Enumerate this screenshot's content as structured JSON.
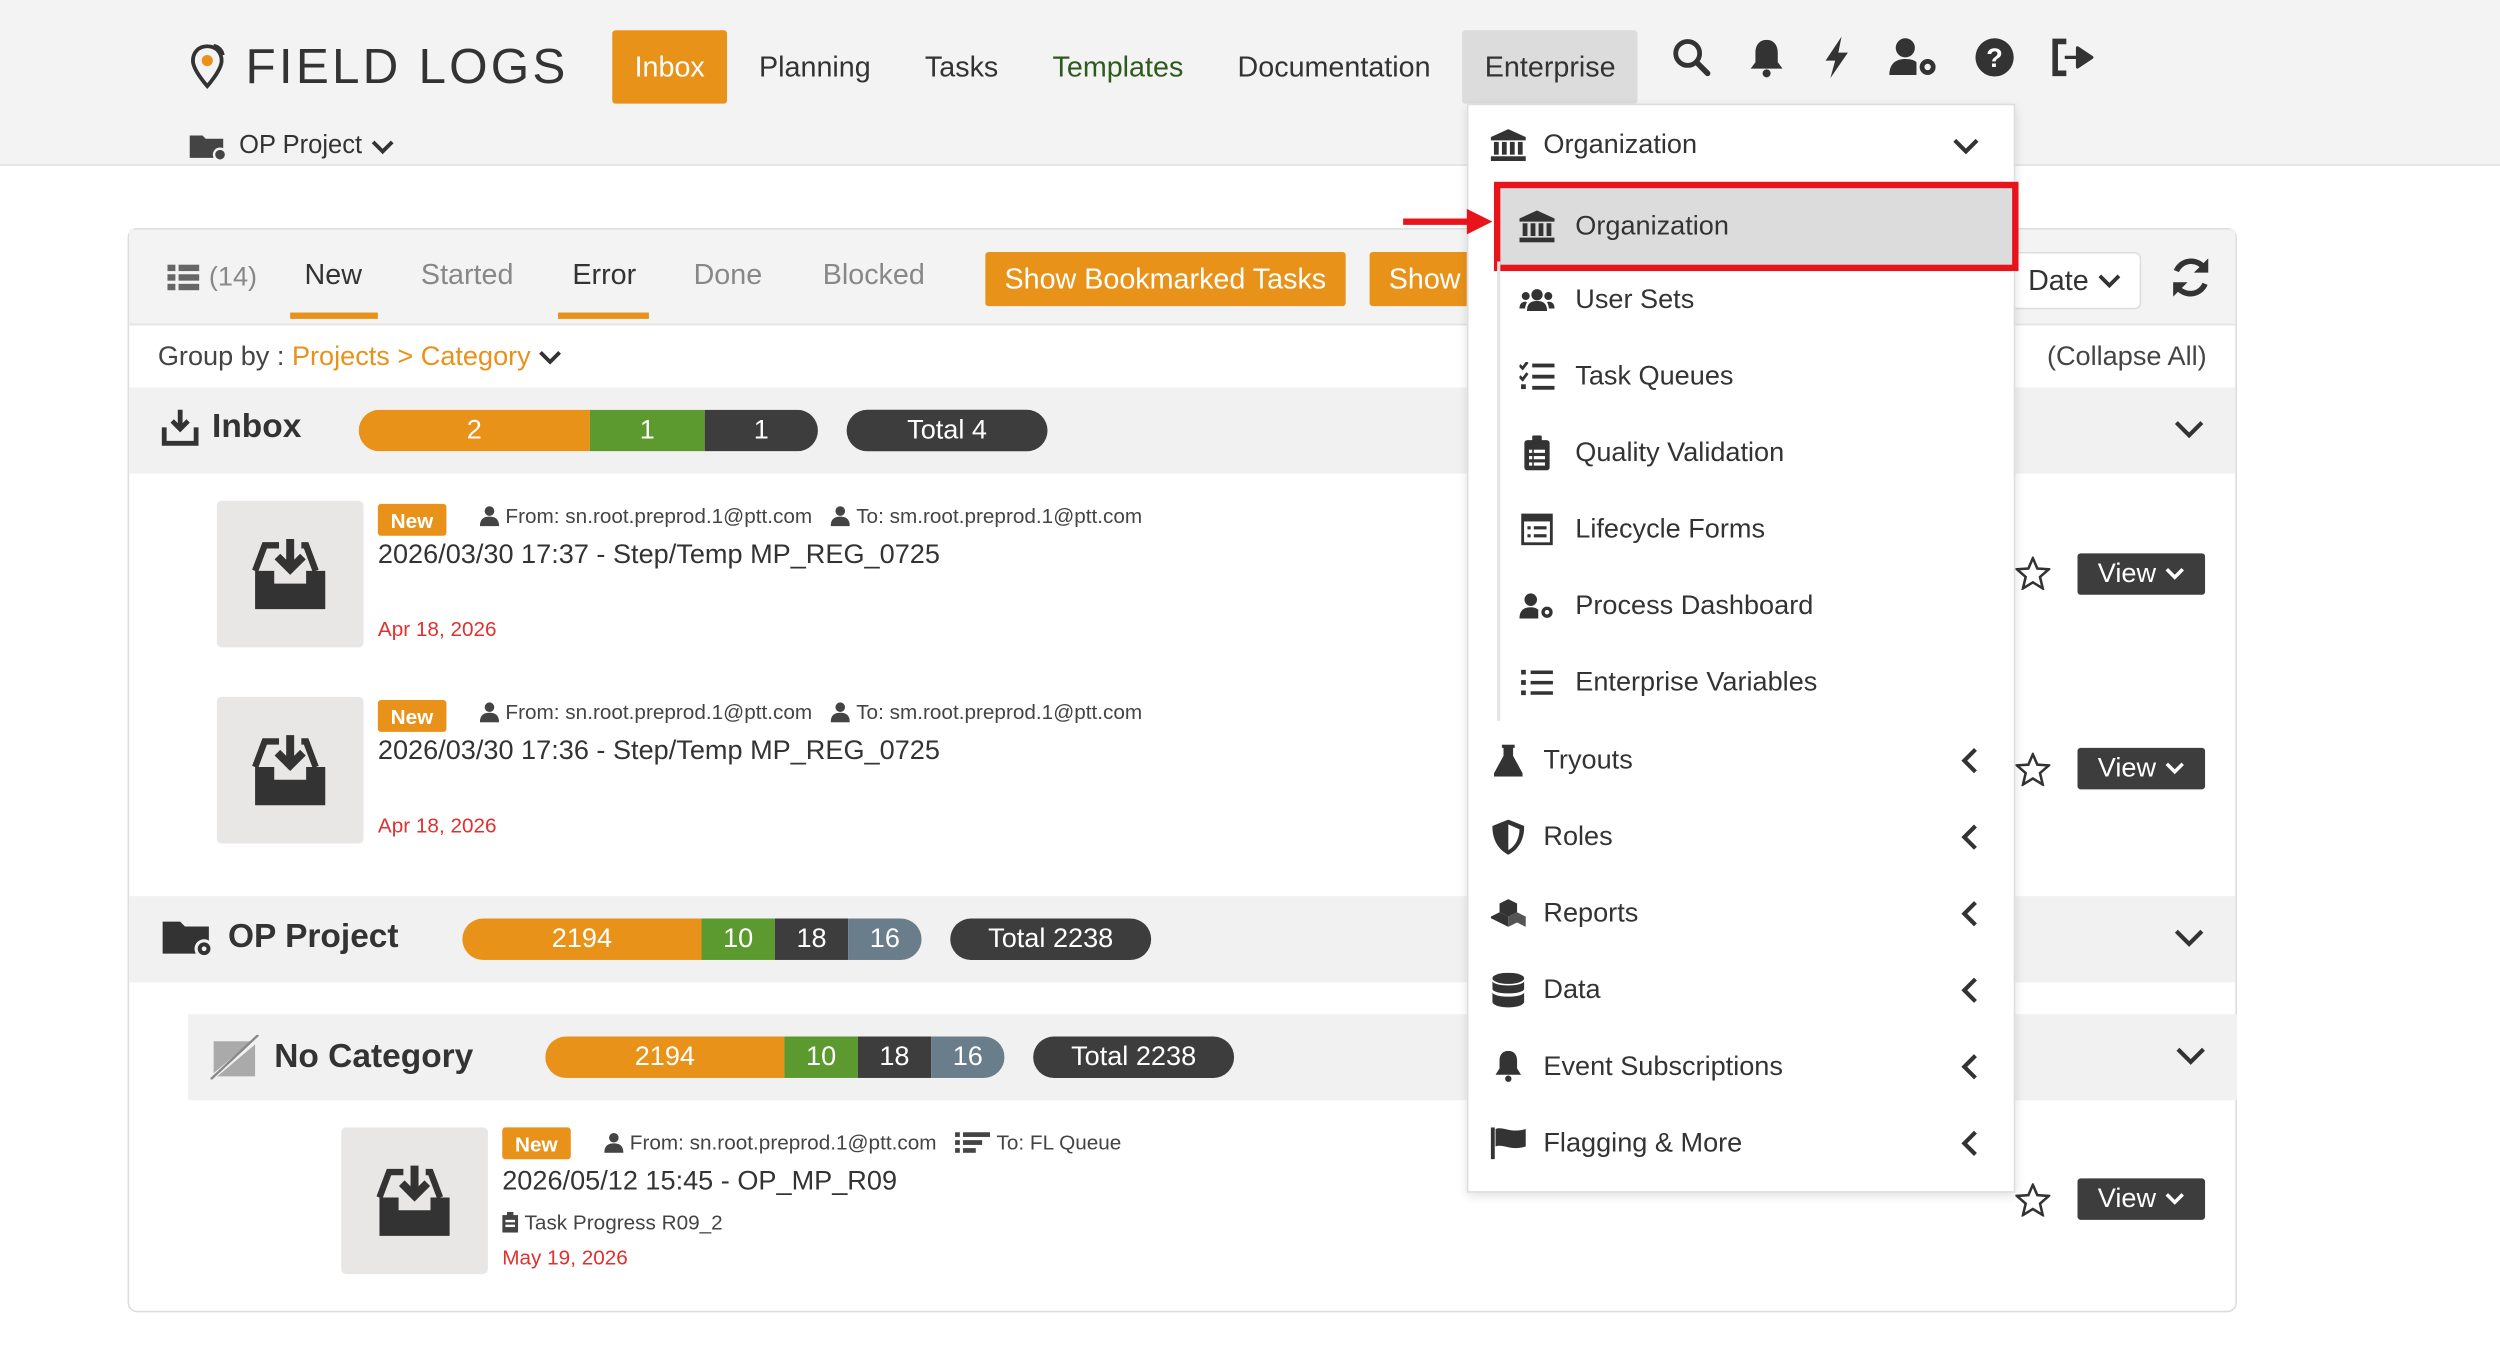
{
  "header": {
    "logo_text": "FIELD LOGS",
    "project_label": "OP Project",
    "nav": [
      {
        "label": "Inbox"
      },
      {
        "label": "Planning"
      },
      {
        "label": "Tasks"
      },
      {
        "label": "Templates"
      },
      {
        "label": "Documentation"
      },
      {
        "label": "Enterprise"
      }
    ],
    "icons": [
      "search-icon",
      "bell-icon",
      "bolt-icon",
      "user-gear-icon",
      "help-icon",
      "logout-icon"
    ]
  },
  "toolbar": {
    "list_count": "(14)",
    "tabs": [
      "New",
      "Started",
      "Error",
      "Done",
      "Blocked"
    ],
    "bookmarked_label": "Show Bookmarked Tasks",
    "show_label": "Show",
    "sort_label": "Date"
  },
  "groupby": {
    "prefix": "Group by : ",
    "value": "Projects > Category",
    "collapse_all": "(Collapse All)"
  },
  "inbox_section": {
    "title": "Inbox",
    "bar": [
      "2",
      "1",
      "1"
    ],
    "total": "Total 4",
    "tasks": [
      {
        "badge": "New",
        "from": "From: sn.root.preprod.1@ptt.com",
        "to": "To: sm.root.preprod.1@ptt.com",
        "title": "2026/03/30 17:37 - Step/Temp MP_REG_0725",
        "date": "Apr 18, 2026",
        "view": "View"
      },
      {
        "badge": "New",
        "from": "From: sn.root.preprod.1@ptt.com",
        "to": "To: sm.root.preprod.1@ptt.com",
        "title": "2026/03/30 17:36 - Step/Temp MP_REG_0725",
        "date": "Apr 18, 2026",
        "view": "View"
      }
    ]
  },
  "project_section": {
    "title": "OP Project",
    "bar": [
      "2194",
      "10",
      "18",
      "16"
    ],
    "total": "Total 2238"
  },
  "category_section": {
    "title": "No Category",
    "bar": [
      "2194",
      "10",
      "18",
      "16"
    ],
    "total": "Total 2238",
    "task": {
      "badge": "New",
      "from": "From: sn.root.preprod.1@ptt.com",
      "to": "To: FL Queue",
      "title": "2026/05/12 15:45 - OP_MP_R09",
      "progress": "Task Progress R09_2",
      "date": "May 19, 2026",
      "view": "View"
    }
  },
  "dropdown": {
    "header": "Organization",
    "subitems": [
      "Organization",
      "User Sets",
      "Task Queues",
      "Quality Validation",
      "Lifecycle Forms",
      "Process Dashboard",
      "Enterprise Variables"
    ],
    "items": [
      "Tryouts",
      "Roles",
      "Reports",
      "Data",
      "Event Subscriptions",
      "Flagging & More"
    ]
  },
  "colors": {
    "accent": "#e8921a",
    "highlight": "#e8141b",
    "green": "#5c9a2f",
    "dark": "#3d3d3d"
  }
}
